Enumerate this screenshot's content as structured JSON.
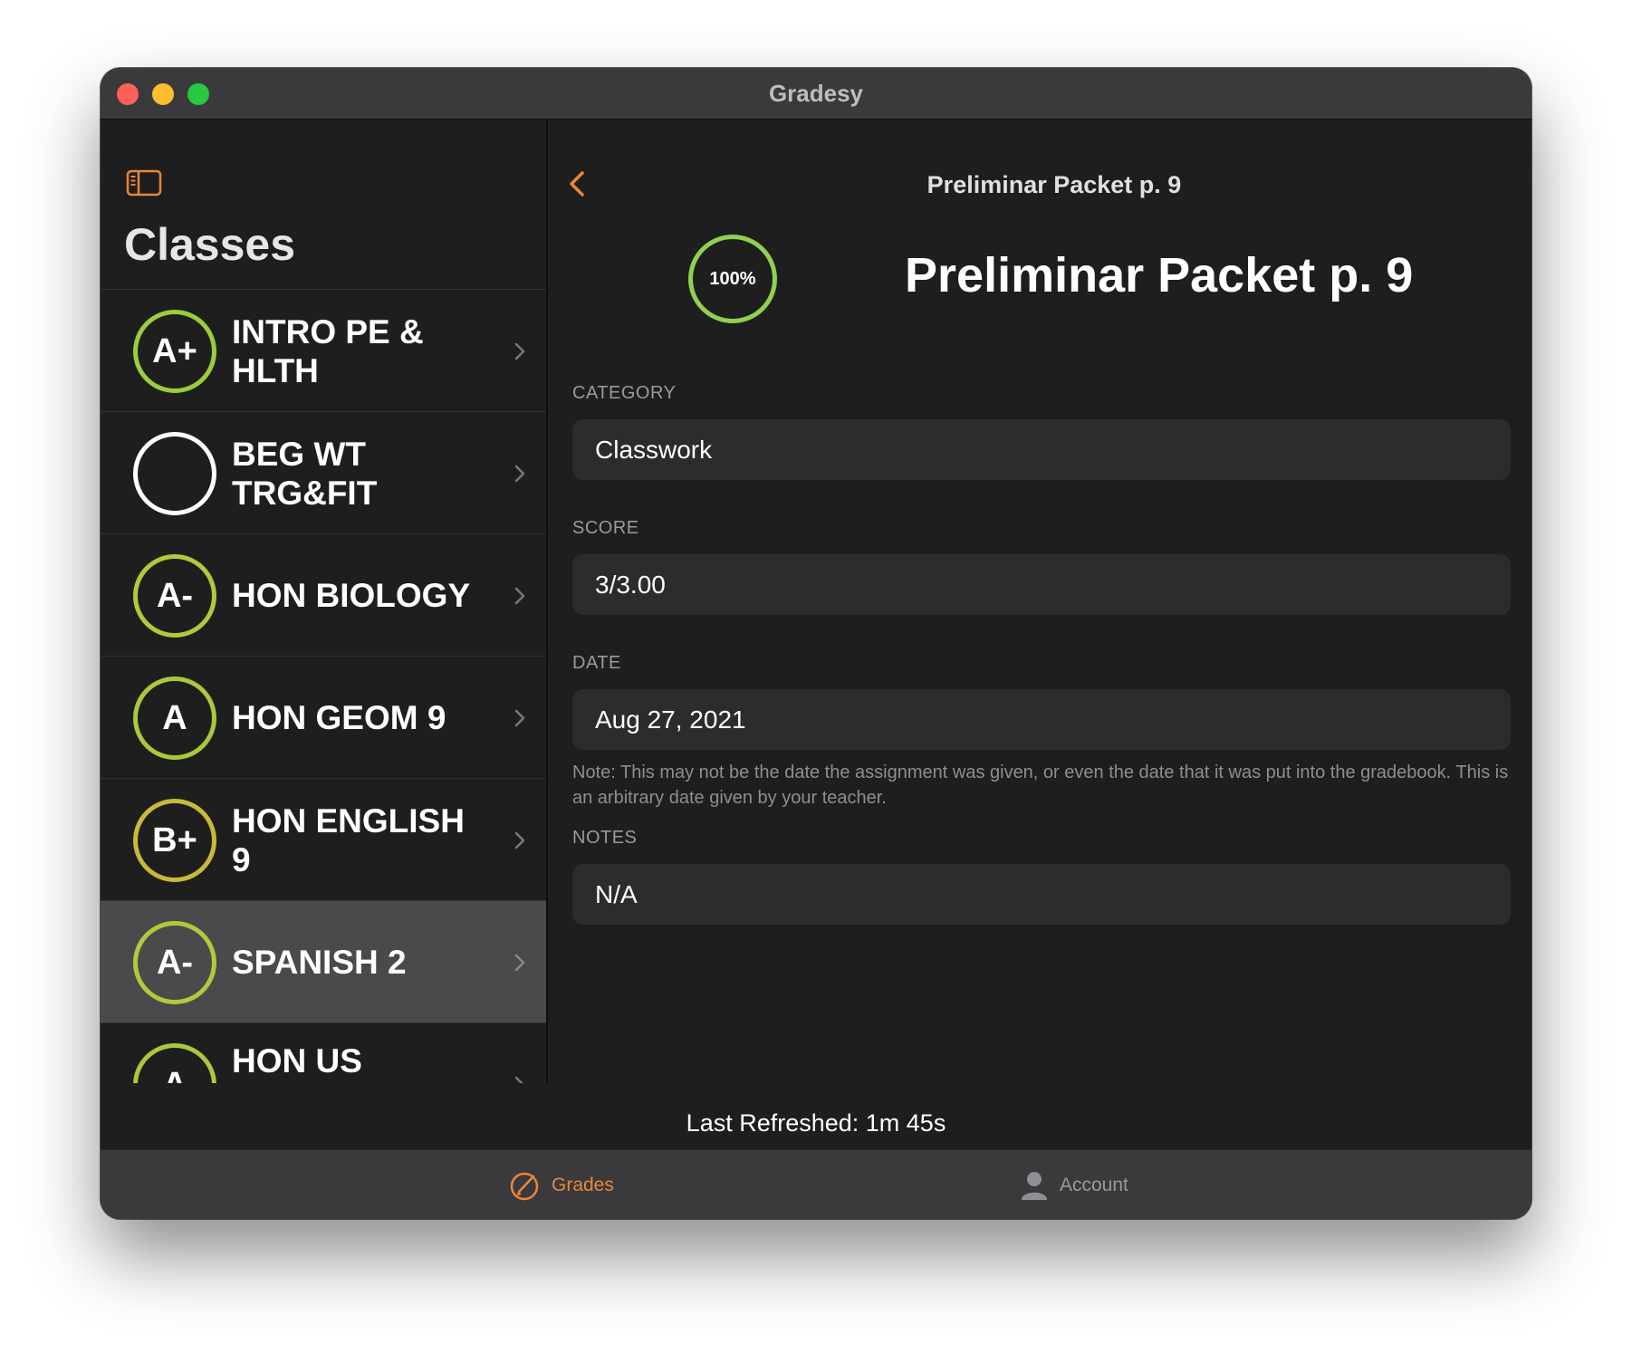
{
  "window": {
    "title": "Gradesy"
  },
  "sidebar": {
    "title": "Classes",
    "classes": [
      {
        "grade": "A+",
        "name": "INTRO PE & HLTH",
        "ring_color": "#9ccc3d"
      },
      {
        "grade": "",
        "name": "BEG WT TRG&FIT",
        "ring_color": "#ffffff"
      },
      {
        "grade": "A-",
        "name": "HON BIOLOGY",
        "ring_color": "#b5c73a"
      },
      {
        "grade": "A",
        "name": "HON GEOM 9",
        "ring_color": "#a9c93b"
      },
      {
        "grade": "B+",
        "name": "HON ENGLISH 9",
        "ring_color": "#c9b93a"
      },
      {
        "grade": "A-",
        "name": "SPANISH 2",
        "ring_color": "#b5c73a",
        "selected": true
      },
      {
        "grade": "A",
        "name": "HON US",
        "ring_color": "#a9c93b"
      }
    ]
  },
  "detail": {
    "nav_title": "Preliminar Packet p. 9",
    "percent": "100%",
    "title": "Preliminar Packet p. 9",
    "category_label": "CATEGORY",
    "category_value": "Classwork",
    "score_label": "SCORE",
    "score_value": "3/3.00",
    "date_label": "DATE",
    "date_value": "Aug 27, 2021",
    "date_note": "Note: This may not be the date the assignment was given, or even the date that it was put into the gradebook. This is an arbitrary date given by your teacher.",
    "notes_label": "NOTES",
    "notes_value": "N/A"
  },
  "footer": {
    "last_refreshed": "Last Refreshed: 1m 45s"
  },
  "tabbar": {
    "grades_label": "Grades",
    "account_label": "Account",
    "active_color": "#e8873a",
    "inactive_color": "#9a9a9a"
  },
  "colors": {
    "accent": "#e8873a",
    "ring_green": "#8fd14f"
  },
  "icons": {
    "sidebar_toggle": "sidebar-toggle-icon",
    "back": "chevron-left-icon",
    "row_chevron": "chevron-right-icon",
    "grades_tab": "grades-pencil-circle-icon",
    "account_tab": "person-icon"
  }
}
